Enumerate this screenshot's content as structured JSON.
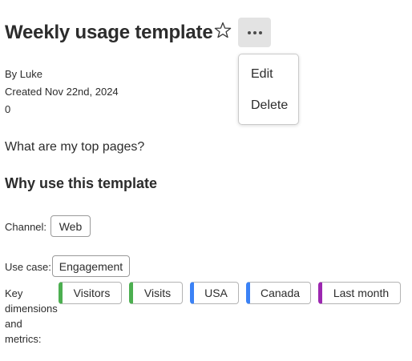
{
  "header": {
    "title": "Weekly usage template",
    "favorite_icon": "star-outline",
    "more_icon": "more-horizontal"
  },
  "menu": {
    "edit_label": "Edit",
    "delete_label": "Delete"
  },
  "meta": {
    "by": "By Luke",
    "created": "Created Nov 22nd, 2024",
    "count": "0"
  },
  "description": "What are my top pages?",
  "section": {
    "heading": "Why use this template",
    "channel_label": "Channel:",
    "channel_value": "Web",
    "use_case_label": "Use case:",
    "use_case_value": "Engagement",
    "key_dimensions_label": "Key dimensions and metrics:",
    "chips": [
      {
        "label": "Visitors",
        "color": "#4caf50"
      },
      {
        "label": "Visits",
        "color": "#4caf50"
      },
      {
        "label": "USA",
        "color": "#3b82f6"
      },
      {
        "label": "Canada",
        "color": "#3b82f6"
      },
      {
        "label": "Last month",
        "color": "#9c27b0"
      }
    ]
  }
}
